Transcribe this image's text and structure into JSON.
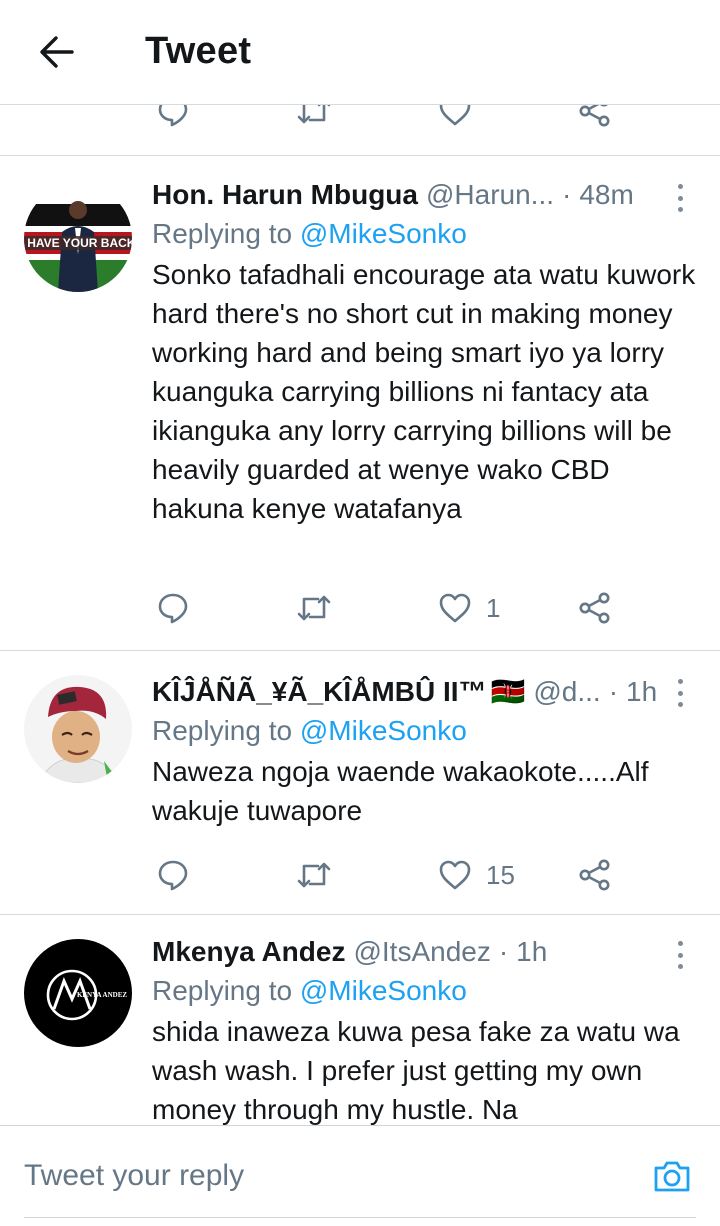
{
  "header": {
    "title": "Tweet",
    "back_icon": "arrow-left-icon"
  },
  "colors": {
    "accent": "#1da1f2",
    "secondary_text": "#657786",
    "divider": "#d6dbdf",
    "heart": "#657786"
  },
  "tweets": [
    {
      "name": "Hon. Harun Mbugua",
      "handle": "@Harun...",
      "time": "48m",
      "replying_prefix": "Replying to ",
      "replying_to": "@MikeSonko",
      "text": "Sonko tafadhali encourage ata watu kuwork hard there's no short cut in making money working hard and being smart iyo ya lorry kuanguka carrying billions ni fantacy ata ikianguka any lorry carrying billions will be heavily guarded at wenye wako CBD hakuna kenye watafanya",
      "avatar_text": "I HAVE YOUR BACK",
      "likes": "1"
    },
    {
      "name": "KÎĴÅÑÃ_¥Ã_KÎÅMBÛ II™",
      "flag": "🇰🇪",
      "handle": "@d...",
      "time": "1h",
      "replying_prefix": "Replying to ",
      "replying_to": "@MikeSonko",
      "text": "Naweza ngoja waende wakaokote.....Alf wakuje tuwapore",
      "likes": "15"
    },
    {
      "name": "Mkenya Andez",
      "handle": "@ItsAndez",
      "time": "1h",
      "replying_prefix": "Replying to ",
      "replying_to": "@MikeSonko",
      "text": "shida inaweza kuwa pesa fake za watu wa wash wash. I prefer just getting my own money through my hustle. Na",
      "avatar_text": "KENYA ANDEZ"
    }
  ],
  "reply_bar": {
    "placeholder": "Tweet your reply",
    "camera_icon": "camera-icon"
  }
}
